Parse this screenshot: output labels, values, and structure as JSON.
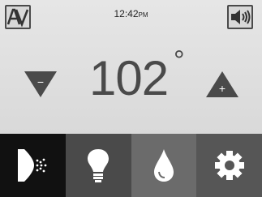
{
  "header": {
    "time": "12:42",
    "ampm": "PM",
    "font_button_label": "AA",
    "volume_icon": "speaker-volume-icon"
  },
  "thermostat": {
    "temperature": "102",
    "unit_symbol": "°",
    "decrease_label": "−",
    "increase_label": "+"
  },
  "nav": {
    "items": [
      {
        "name": "spray",
        "icon": "spray-nozzle-icon",
        "selected": true
      },
      {
        "name": "light",
        "icon": "lightbulb-icon",
        "selected": false
      },
      {
        "name": "water",
        "icon": "water-drop-icon",
        "selected": false
      },
      {
        "name": "settings",
        "icon": "gear-icon",
        "selected": false
      }
    ]
  },
  "colors": {
    "display_bg": "#e0e0e0",
    "text": "#4a4a4a",
    "nav_selected": "#111111",
    "nav_default": "#4a4a4a"
  }
}
